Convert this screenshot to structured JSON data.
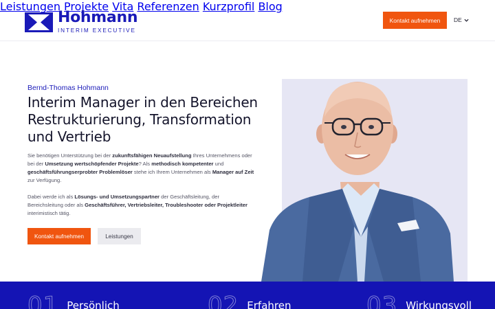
{
  "brand": {
    "name": "Hohmann",
    "tagline": "INTERIM EXECUTIVE",
    "color": "#1a1ab8"
  },
  "nav": {
    "items": [
      "Leistungen",
      "Projekte",
      "Vita",
      "Referenzen",
      "Kurzprofil",
      "Blog"
    ],
    "cta_label": "Kontakt aufnehmen",
    "language": "DE"
  },
  "hero": {
    "eyebrow": "Bernd-Thomas Hohmann",
    "headline": "Interim Manager in den Bereichen Restrukturierung, Transformation und Vertrieb",
    "paragraph1": [
      {
        "t": "Sie benötigen Unterstützung bei der ",
        "b": false
      },
      {
        "t": "zukunftsfähigen Neuaufstellung",
        "b": true
      },
      {
        "t": " Ihres Unternehmens oder bei der ",
        "b": false
      },
      {
        "t": "Umsetzung wertschöpfender Projekte",
        "b": true
      },
      {
        "t": "? Als ",
        "b": false
      },
      {
        "t": "methodisch kompetenter",
        "b": true
      },
      {
        "t": " und ",
        "b": false
      },
      {
        "t": "geschäftsführungserprobter Problemlöser",
        "b": true
      },
      {
        "t": " stehe ich Ihrem Unternehmen als ",
        "b": false
      },
      {
        "t": "Manager auf Zeit",
        "b": true
      },
      {
        "t": " zur Verfügung.",
        "b": false
      }
    ],
    "paragraph2": [
      {
        "t": "Dabei werde ich als ",
        "b": false
      },
      {
        "t": "Lösungs- und Umsetzungspartner",
        "b": true
      },
      {
        "t": " der Geschäftsleitung, der Bereichsleitung oder als ",
        "b": false
      },
      {
        "t": "Geschäftsführer, Vertriebsleiter, Troubleshooter oder Projektleiter",
        "b": true
      },
      {
        "t": " interimistisch tätig.",
        "b": false
      }
    ],
    "primary_button": "Kontakt aufnehmen",
    "secondary_button": "Leistungen"
  },
  "features": [
    {
      "number": "01",
      "label": "Persönlich"
    },
    {
      "number": "02",
      "label": "Erfahren"
    },
    {
      "number": "03",
      "label": "Wirkungsvoll"
    }
  ],
  "colors": {
    "accent": "#f0550f",
    "band": "#1414b4",
    "portrait_bg": "#e6e6f4"
  }
}
